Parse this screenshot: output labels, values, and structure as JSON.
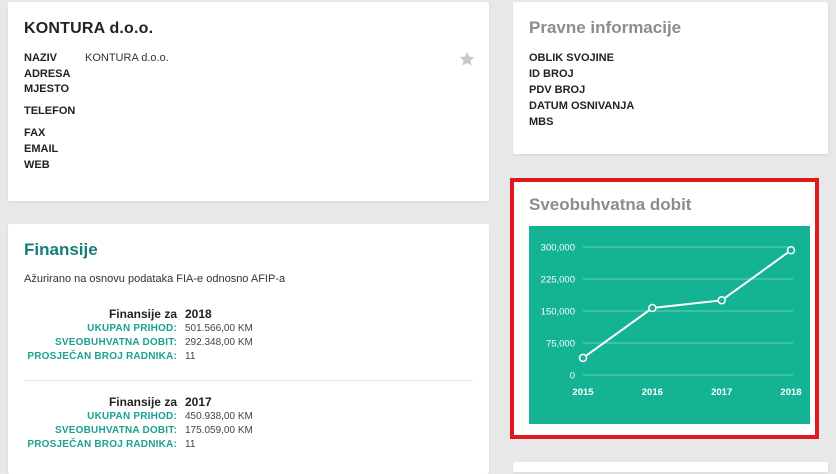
{
  "company": {
    "title": "KONTURA d.o.o.",
    "fields": [
      {
        "label": "NAZIV",
        "value": "KONTURA d.o.o."
      },
      {
        "label": "ADRESA",
        "value": ""
      },
      {
        "label": "MJESTO",
        "value": ""
      },
      {
        "label": "TELEFON",
        "value": ""
      },
      {
        "label": "FAX",
        "value": ""
      },
      {
        "label": "EMAIL",
        "value": ""
      },
      {
        "label": "WEB",
        "value": ""
      }
    ],
    "favorite_icon": "star-icon"
  },
  "legal": {
    "title": "Pravne informacije",
    "items": [
      "OBLIK SVOJINE",
      "ID BROJ",
      "PDV BROJ",
      "DATUM OSNIVANJA",
      "MBS"
    ]
  },
  "finance": {
    "title": "Finansije",
    "subtitle": "Ažurirano na osnovu podataka FIA-e odnosno AFIP-a",
    "for_label": "Finansije za",
    "years": [
      {
        "year": "2018",
        "rows": [
          {
            "label": "UKUPAN PRIHOD:",
            "value": "501.566,00 KM"
          },
          {
            "label": "SVEOBUHVATNA DOBIT:",
            "value": "292.348,00 KM"
          },
          {
            "label": "PROSJEČAN BROJ RADNIKA:",
            "value": "11"
          }
        ]
      },
      {
        "year": "2017",
        "rows": [
          {
            "label": "UKUPAN PRIHOD:",
            "value": "450.938,00 KM"
          },
          {
            "label": "SVEOBUHVATNA DOBIT:",
            "value": "175.059,00 KM"
          },
          {
            "label": "PROSJEČAN BROJ RADNIKA:",
            "value": "11"
          }
        ]
      }
    ]
  },
  "chart_card": {
    "title": "Sveobuhvatna dobit"
  },
  "chart_data": {
    "type": "line",
    "title": "Sveobuhvatna dobit",
    "x": [
      "2015",
      "2016",
      "2017",
      "2018"
    ],
    "values": [
      40000,
      157000,
      175059,
      292348
    ],
    "ylim": [
      0,
      300000
    ],
    "yticks": [
      0,
      75000,
      150000,
      225000,
      300000
    ],
    "ytick_labels": [
      "0",
      "75,000",
      "150,000",
      "225,000",
      "300,000"
    ],
    "xlabel": "",
    "ylabel": "",
    "grid": true,
    "colors": {
      "background": "#14b393",
      "line": "#ffffff",
      "grid": "#5fd0b9",
      "highlight": "#e0191f"
    }
  }
}
